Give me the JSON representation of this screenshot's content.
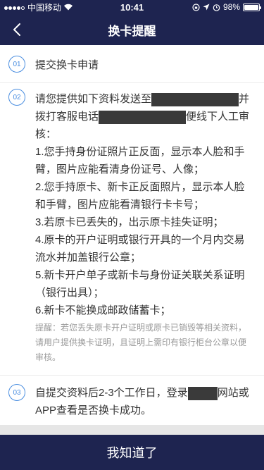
{
  "status": {
    "carrier": "中国移动",
    "time": "10:41",
    "battery": "98%",
    "battery_level": 0.98
  },
  "nav": {
    "title": "换卡提醒",
    "back_icon": "chevron-left-icon"
  },
  "steps": [
    {
      "num": "01",
      "text": "提交换卡申请"
    },
    {
      "num": "02",
      "intro_a": "请您提供如下资料发送至",
      "intro_b": "并拨",
      "intro_c": "打客服电话",
      "intro_d": "便线下人工审核：",
      "items": [
        "1.您手持身份证照片正反面，显示本人脸和手臂，图片应能看清身份证号、人像；",
        "2.您手持原卡、新卡正反面照片，显示本人脸和手臂，图片应能看清银行卡卡号；",
        "3.若原卡已丢失的，出示原卡挂失证明；",
        "4.原卡的开户证明或银行开具的一个月内交易流水并加盖银行公章；",
        "5.新卡开户单子或新卡与身份证关联关系证明（银行出具）；",
        "6.新卡不能换成邮政储蓄卡；"
      ],
      "tip": "提醒：若您丢失原卡开户证明或原卡已销毁等相关资料，请用户提供换卡证明，且证明上需印有银行柜台公章以便审核。"
    },
    {
      "num": "03",
      "text_a": "自提交资料后2-3个工作日，登录",
      "text_b": "网站或APP查看是否换卡成功。"
    }
  ],
  "footer": {
    "confirm_label": "我知道了"
  },
  "colors": {
    "nav_bg": "#1e2450",
    "accent": "#4a8ee0",
    "redaction": "#3a3a3a"
  }
}
